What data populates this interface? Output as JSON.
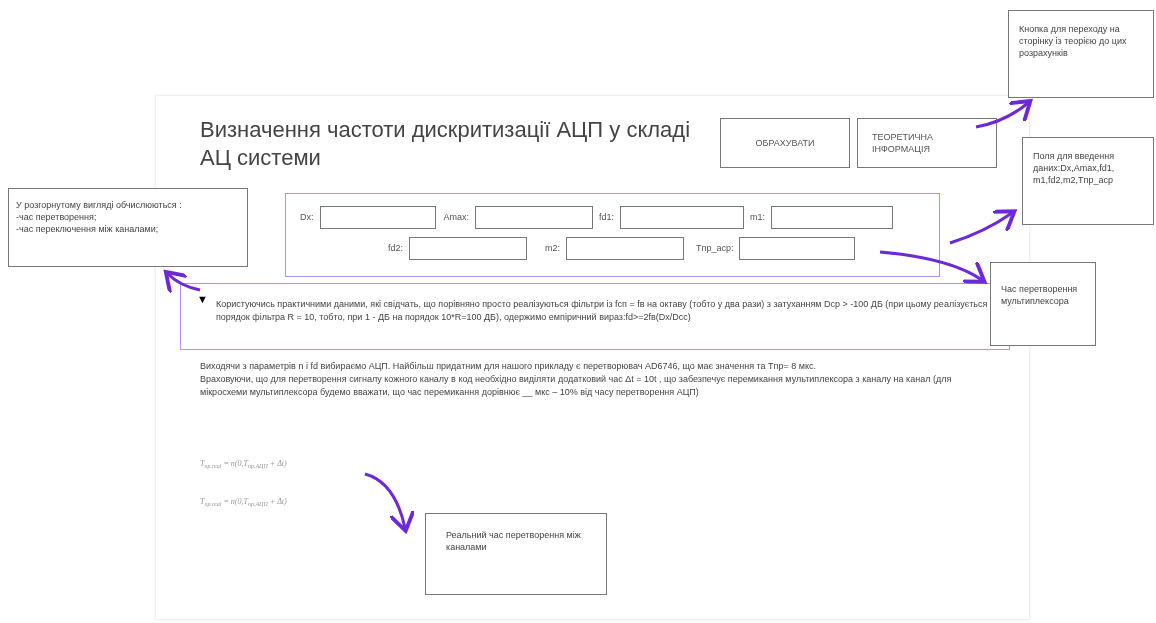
{
  "title": "Визначення частоти дискритизації АЦП у складі АЦ системи",
  "buttons": [
    "ОБРАХУВАТИ",
    "ТЕОРЕТИЧНА ІНФОРМАЦІЯ"
  ],
  "input_rows": [
    [
      {
        "label": "Dx:"
      },
      {
        "label": "Amax:"
      },
      {
        "label": "fd1:"
      },
      {
        "label": "m1:"
      }
    ],
    [
      {
        "label": "fd2:"
      },
      {
        "label": "m2:"
      },
      {
        "label": "Tпр_аср:"
      }
    ]
  ],
  "details": {
    "expanded": true,
    "toggle": "▼",
    "text": "Користуючись практичними даними, які свідчать, що порівняно просто реалізуються фільтри із fcп = fв на октаву (тобто у два рази) з затуханням Dcp > -100 ДБ (при цьому реалізується порядок фільтра R = 10, тобто, при 1 - ДБ на порядок 10*R=100 ДБ), одержимо емпіричний вираз:fd>=2fв(Dx/Dcc)"
  },
  "paragraphs": [
    "Виходячи з параметрів n і fd вибираємо АЦП. Найбільш придатним для нашого прикладу є перетворювач AD6746, що має значення та Tпр= 8 мкс.",
    "Враховуючи, що для перетворення сигналу кожного каналу в код необхідно виділяти додатковий час Δt = 10t , що забезпечує перемикання мультиплексора з каналу на канал (для мікросхеми мультиплексора будемо вважати, що час перемикання дорівнює __ мкс – 10% від часу перетворення АЦП)"
  ],
  "formulas": [
    "T$_{пр.real}$ = n(0,T$_{пр.АЦП}$ + Δt)",
    "T$_{пр.real}$ = n(0,T$_{пр.АЦП}$ + Δt)"
  ],
  "annotations": [
    {
      "kind": "note",
      "text": "Кнопка для переходу на сторінку із теорією до цих розрахунків"
    },
    {
      "kind": "note",
      "text": "Поля для введення даних:Dx,Amax,fd1, m1,fd2,m2,Tпр_аср"
    },
    {
      "kind": "note",
      "text": "У розгорнутому вигляді обчислюються :\n-час перетворення;\n-час переключення між каналами;"
    },
    {
      "kind": "note",
      "text": "Час перетворення мультиплексора"
    },
    {
      "kind": "note",
      "text": "Реальний час перетворення між каналами"
    }
  ]
}
